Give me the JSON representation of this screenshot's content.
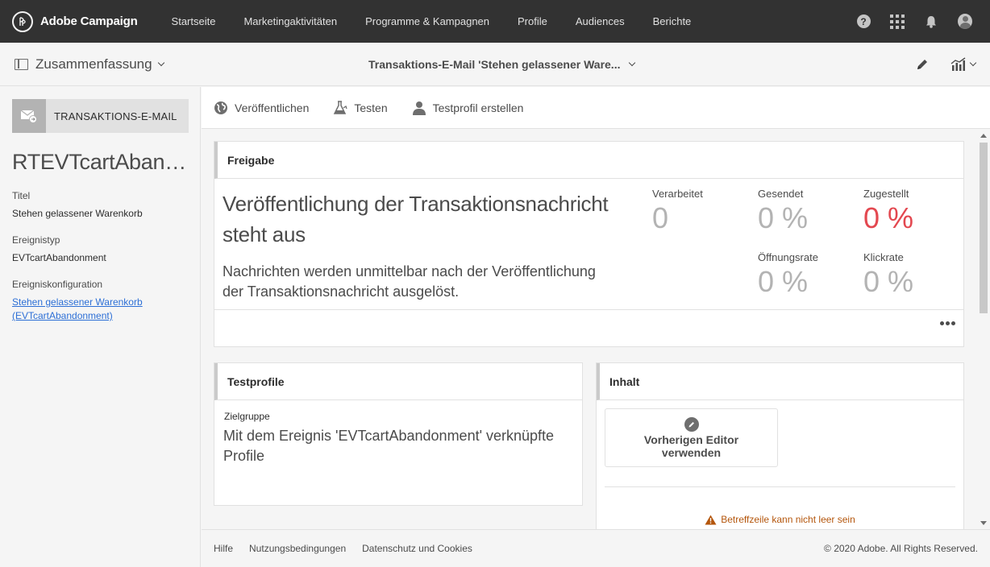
{
  "app": {
    "name": "Adobe Campaign",
    "logo_glyph": "₯"
  },
  "topnav": {
    "items": [
      "Startseite",
      "Marketingaktivitäten",
      "Programme & Kampagnen",
      "Profile",
      "Audiences",
      "Berichte"
    ],
    "help_glyph": "?"
  },
  "subbar": {
    "summary_label": "Zusammenfassung",
    "document_title": "Transaktions-E-Mail 'Stehen gelassener Ware..."
  },
  "sidebar": {
    "type_label": "TRANSAKTIONS-E-MAIL",
    "title": "RTEVTcartAbandonment",
    "fields": {
      "titel_label": "Titel",
      "titel_value": "Stehen gelassener Warenkorb",
      "ereignistyp_label": "Ereignistyp",
      "ereignistyp_value": "EVTcartAbandonment",
      "ereigniskonfiguration_label": "Ereigniskonfiguration",
      "ereigniskonfiguration_link": "Stehen gelassener Warenkorb (EVTcartAbandonment)"
    }
  },
  "actions": {
    "publish": "Veröffentlichen",
    "test": "Testen",
    "create_test_profile": "Testprofil erstellen"
  },
  "freigabe": {
    "header": "Freigabe",
    "main_text": "Veröffentlichung der Transaktionsnachricht steht aus",
    "sub_text": "Nachrichten werden unmittelbar nach der Veröffentlichung der Transaktionsnachricht ausgelöst.",
    "stats": {
      "verarbeitet": {
        "label": "Verarbeitet",
        "value": "0"
      },
      "gesendet": {
        "label": "Gesendet",
        "value": "0 %"
      },
      "zugestellt": {
        "label": "Zugestellt",
        "value": "0 %"
      },
      "oeffnungsrate": {
        "label": "Öffnungsrate",
        "value": "0 %"
      },
      "klickrate": {
        "label": "Klickrate",
        "value": "0 %"
      }
    }
  },
  "testprofile": {
    "header": "Testprofile",
    "zielgruppe_label": "Zielgruppe",
    "zielgruppe_value": "Mit dem Ereignis 'EVTcartAbandonment' verknüpfte Profile"
  },
  "inhalt": {
    "header": "Inhalt",
    "editor_button": "Vorherigen Editor verwenden",
    "warning": "Betreffzeile kann nicht leer sein"
  },
  "footer": {
    "links": [
      "Hilfe",
      "Nutzungsbedingungen",
      "Datenschutz und Cookies"
    ],
    "copyright": "© 2020 Adobe. All Rights Reserved."
  },
  "colors": {
    "topnav_bg": "#323232",
    "accent_red": "#e34850",
    "link_blue": "#2d6fd6",
    "warning_orange": "#b4560c"
  }
}
